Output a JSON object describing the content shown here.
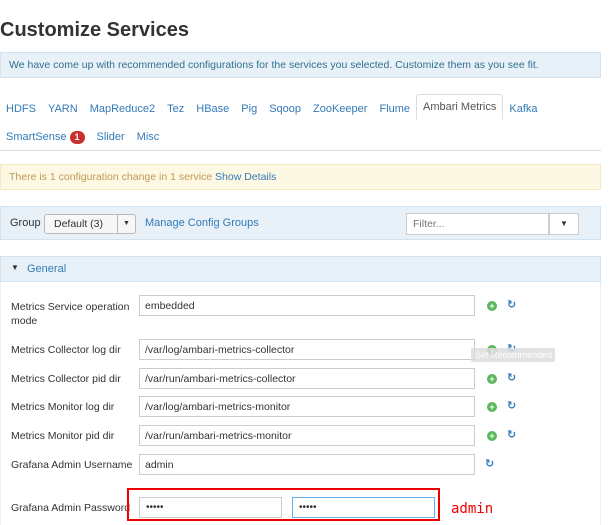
{
  "page_title": "Customize Services",
  "info_banner": "We have come up with recommended configurations for the services you selected. Customize them as you see fit.",
  "tabs_row1": [
    "HDFS",
    "YARN",
    "MapReduce2",
    "Tez",
    "HBase",
    "Pig",
    "Sqoop",
    "ZooKeeper",
    "Flume",
    "Ambari Metrics",
    "Kafka"
  ],
  "tabs_row2": [
    "SmartSense",
    "Slider",
    "Misc"
  ],
  "active_tab": "Ambari Metrics",
  "smartsense_badge": "1",
  "warning": {
    "text": "There is 1 configuration change in 1 service ",
    "link": "Show Details"
  },
  "group_bar": {
    "label": "Group",
    "selected": "Default (3)",
    "manage_link": "Manage Config Groups",
    "filter_placeholder": "Filter..."
  },
  "section": {
    "title": "General",
    "expanded": true
  },
  "fields": [
    {
      "label": "Metrics Service operation mode",
      "value": "embedded",
      "has_add": true
    },
    {
      "label": "Metrics Collector log dir",
      "value": "/var/log/ambari-metrics-collector",
      "has_add": true
    },
    {
      "label": "Metrics Collector pid dir",
      "value": "/var/run/ambari-metrics-collector",
      "has_add": true
    },
    {
      "label": "Metrics Monitor log dir",
      "value": "/var/log/ambari-metrics-monitor",
      "has_add": true
    },
    {
      "label": "Metrics Monitor pid dir",
      "value": "/var/run/ambari-metrics-monitor",
      "has_add": true
    },
    {
      "label": "Grafana Admin Username",
      "value": "admin",
      "has_add": false
    }
  ],
  "password_field": {
    "label": "Grafana Admin Password",
    "value": "admin",
    "confirm_value": "admin"
  },
  "tooltip_text": "Set Recommended",
  "annotation": "admin",
  "icons": {
    "add": "plus-circle-icon",
    "refresh": "refresh-icon",
    "caret": "caret-down-icon"
  },
  "colors": {
    "link": "#337ab7",
    "info_bg": "#e8f1f8",
    "warn_bg": "#fcf8e3",
    "badge": "#c9302c",
    "annotation": "#e00000"
  }
}
